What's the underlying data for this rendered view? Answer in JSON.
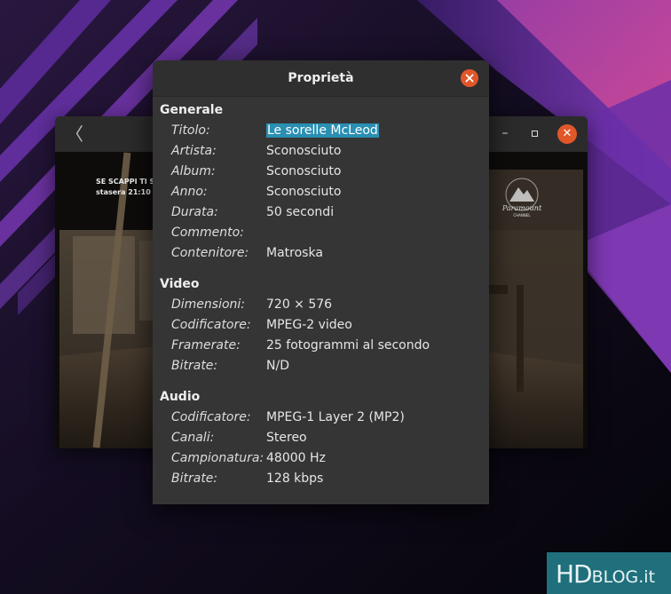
{
  "wallpaper": {
    "colors": {
      "base": "#0d0b14",
      "purple": "#5a2a8a",
      "magenta": "#c93a9a",
      "violet": "#7d3fc4"
    }
  },
  "player": {
    "icons": {
      "back": "chevron-left-icon",
      "minimize": "minimize-icon",
      "maximize": "maximize-icon",
      "close": "close-icon"
    },
    "glyphs": {
      "back": "〈",
      "minimize": "–",
      "close": "✕"
    },
    "overlay_line1": "SE SCAPPI TI S",
    "overlay_line2": "stasera 21:10",
    "channel_logo_name": "Paramount",
    "channel_logo_sub": "CHANNEL"
  },
  "dialog": {
    "title": "Proprietà",
    "close_icon": "close-icon",
    "sections": {
      "general": {
        "title": "Generale",
        "rows": [
          {
            "label": "Titolo:",
            "value": "Le sorelle McLeod"
          },
          {
            "label": "Artista:",
            "value": "Sconosciuto"
          },
          {
            "label": "Album:",
            "value": "Sconosciuto"
          },
          {
            "label": "Anno:",
            "value": "Sconosciuto"
          },
          {
            "label": "Durata:",
            "value": "50 secondi"
          },
          {
            "label": "Commento:",
            "value": ""
          },
          {
            "label": "Contenitore:",
            "value": "Matroska"
          }
        ]
      },
      "video": {
        "title": "Video",
        "rows": [
          {
            "label": "Dimensioni:",
            "value": "720 × 576"
          },
          {
            "label": "Codificatore:",
            "value": "MPEG-2 video"
          },
          {
            "label": "Framerate:",
            "value": "25 fotogrammi al secondo"
          },
          {
            "label": "Bitrate:",
            "value": "N/D"
          }
        ]
      },
      "audio": {
        "title": "Audio",
        "rows": [
          {
            "label": "Codificatore:",
            "value": "MPEG-1 Layer 2 (MP2)"
          },
          {
            "label": "Canali:",
            "value": "Stereo"
          },
          {
            "label": "Campionatura:",
            "value": "48000 Hz"
          },
          {
            "label": "Bitrate:",
            "value": "128 kbps"
          }
        ]
      }
    },
    "colors": {
      "background": "#353535",
      "selection": "#2a8fb2",
      "close": "#e0572a"
    }
  },
  "watermark": {
    "brand": "HD",
    "suffix": "BLOG.it",
    "color": "#1f6f7c"
  }
}
